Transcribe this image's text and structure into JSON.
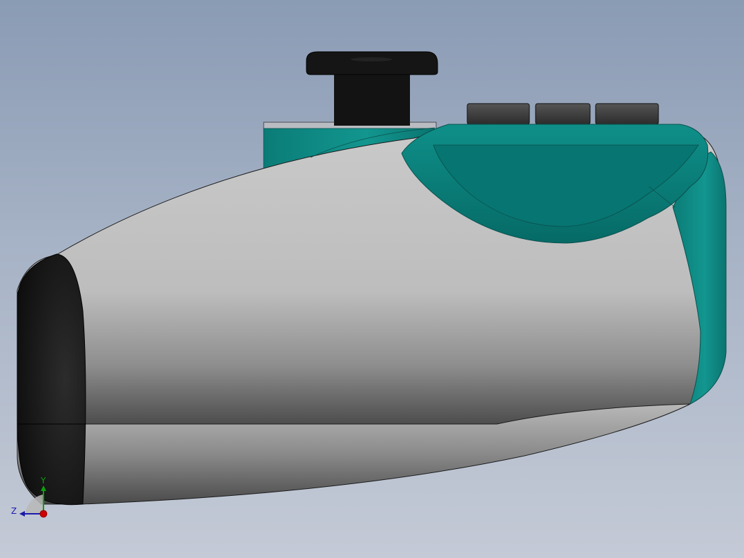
{
  "view": {
    "background_top": "#8a9bb4",
    "background_bottom": "#c4cad6"
  },
  "model": {
    "body_color": "#c8c8c8",
    "accent_color": "#0d8580",
    "accent_dark": "#066863",
    "black_color": "#111111",
    "button_color": "#3a3a3a"
  },
  "triad": {
    "x_color": "#cc0000",
    "y_label": "Y",
    "y_color": "#0ca00c",
    "z_label": "Z",
    "z_color": "#1a1aaa"
  }
}
